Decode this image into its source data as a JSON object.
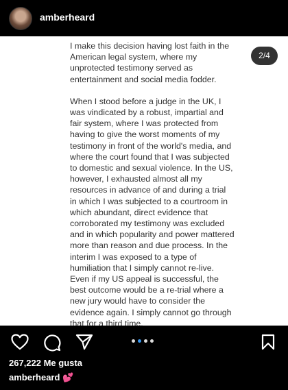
{
  "header": {
    "username": "amberheard"
  },
  "post": {
    "paragraphs": [
      "I make this decision having lost faith in the American legal system, where my unprotected testimony served as entertainment and social media fodder.",
      "When I stood before a judge in the UK, I was vindicated by a robust, impartial and fair system, where I was protected from having to give the worst moments of my testimony in front of the world's media, and where the court found that I was subjected to domestic and sexual violence. In the US, however, I exhausted almost all my resources in advance of and during a trial in which I was subjected to a courtroom in which abundant, direct evidence that corroborated my testimony was excluded and in which popularity and power mattered more than reason and due process. In the interim I was exposed to a type of humiliation that I simply cannot re-live.",
      "Even if my US appeal is successful, the best outcome would be a re-trial where a new jury would have to consider the evidence again. I simply cannot go through that for a third time."
    ],
    "page_counter": "2/4"
  },
  "carousel": {
    "total": 4,
    "active_index": 1
  },
  "footer": {
    "likes": "267,222 Me gusta",
    "caption_user": "amberheard",
    "caption_emoji": "💕"
  },
  "icons": {
    "like": "heart-icon",
    "comment": "comment-icon",
    "share": "send-icon",
    "save": "bookmark-icon"
  }
}
